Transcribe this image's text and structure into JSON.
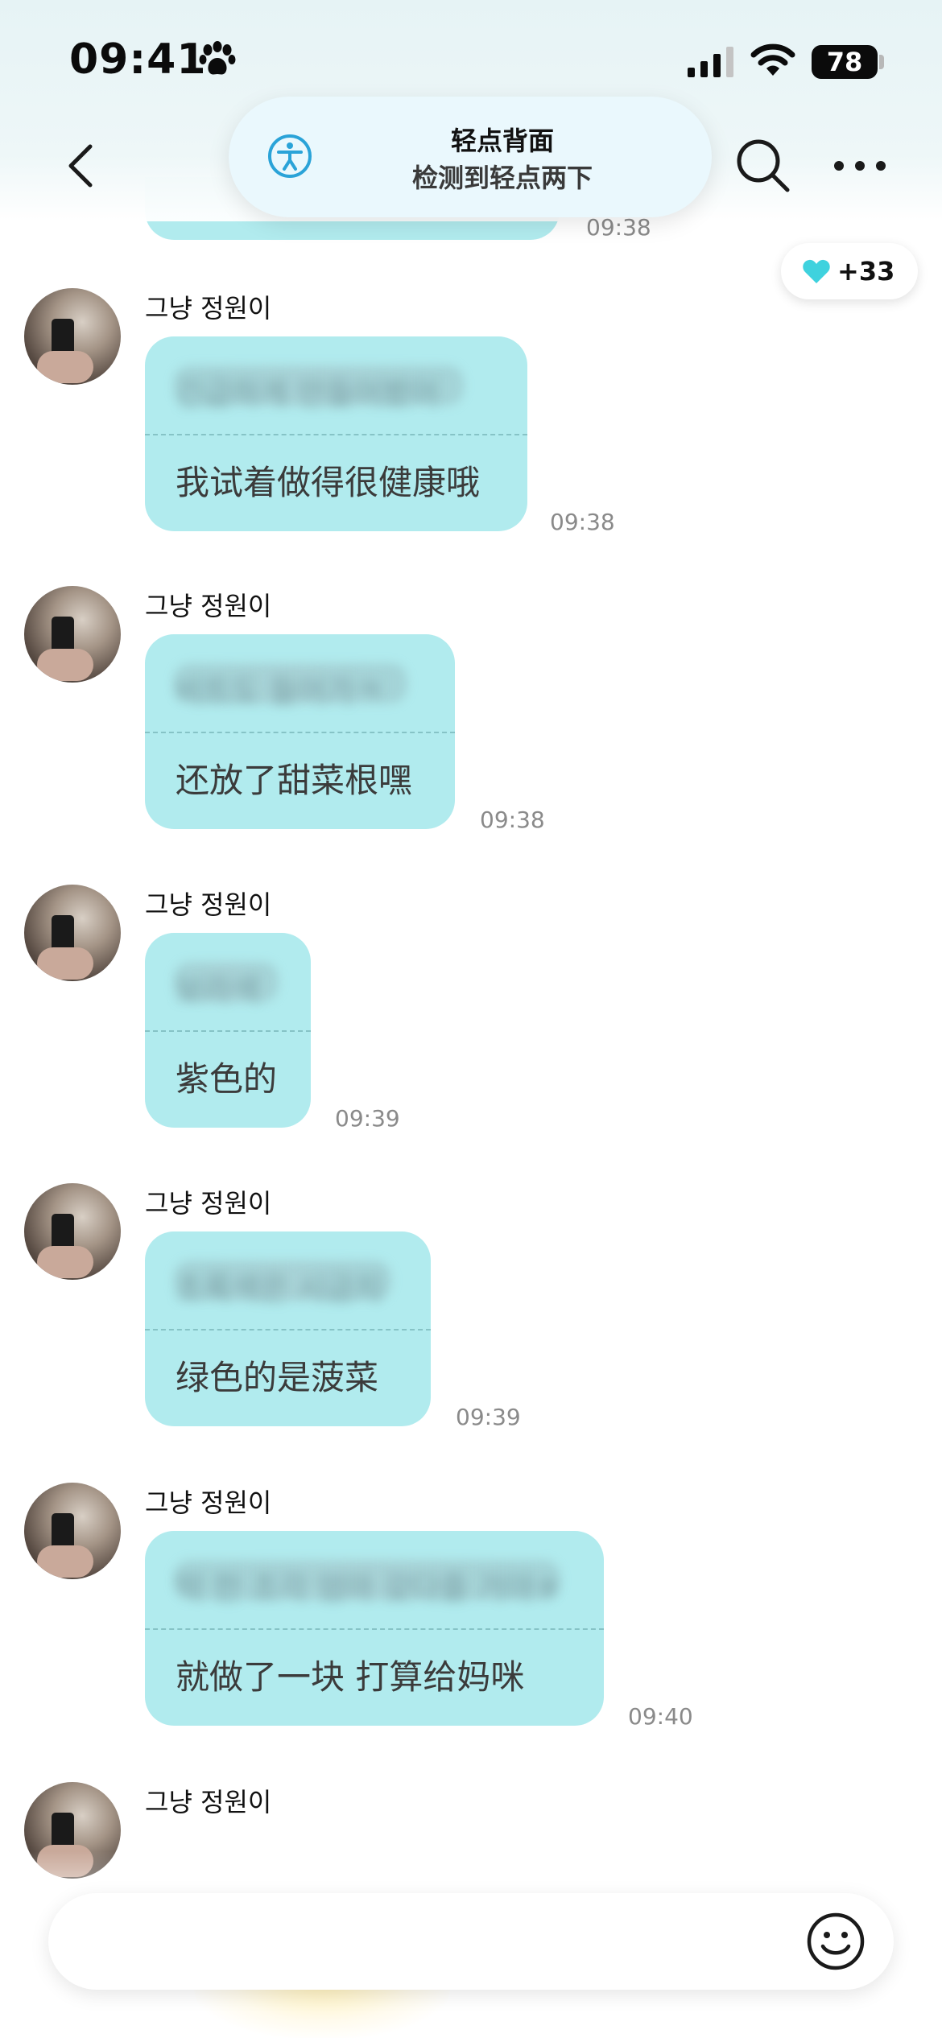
{
  "status_bar": {
    "time": "09:41",
    "battery": "78"
  },
  "banner": {
    "title": "轻点背面",
    "subtitle": "检测到轻点两下"
  },
  "top_partial": {
    "time": "09:38"
  },
  "heart": {
    "count": "+33",
    "color": "#3fd2de"
  },
  "messages": [
    {
      "sender": "그냥 정원이",
      "blurred": "긴급하게 만들어봤어",
      "text": "我试着做得很健康哦",
      "time": "09:38"
    },
    {
      "sender": "그냥 정원이",
      "blurred": "비트도 들어가ㅋ",
      "text": "还放了甜菜根嘿",
      "time": "09:38"
    },
    {
      "sender": "그냥 정원이",
      "blurred": "보라색",
      "text": "紫色的",
      "time": "09:39"
    },
    {
      "sender": "그냥 정원이",
      "blurred": "초록색은 시금치",
      "text": "绿色的是菠菜",
      "time": "09:39"
    },
    {
      "sender": "그냥 정원이",
      "blurred": "딱 한 조각 엄마 갖다줄 거야ㅎ",
      "text": "就做了一块 打算给妈咪",
      "time": "09:40"
    },
    {
      "sender": "그냥 정원이"
    }
  ],
  "colors": {
    "bubble": "#b1ebee",
    "accent": "#2aa3d8"
  }
}
